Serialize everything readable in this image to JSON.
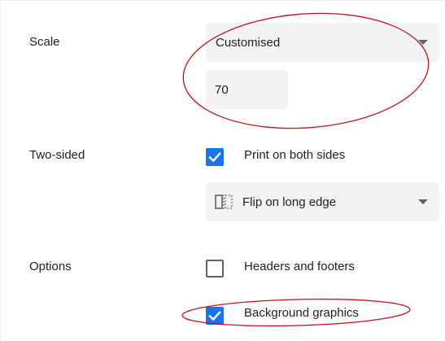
{
  "scale": {
    "label": "Scale",
    "select_value": "Customised",
    "input_value": "70"
  },
  "two_sided": {
    "label": "Two-sided",
    "checkbox_label": "Print on both sides",
    "checked": true,
    "select_value": "Flip on long edge"
  },
  "options": {
    "label": "Options",
    "headers_footers_label": "Headers and footers",
    "headers_footers_checked": false,
    "background_graphics_label": "Background graphics",
    "background_graphics_checked": true
  },
  "colors": {
    "accent": "#1a73e8",
    "field_background": "#f1f3f4",
    "annotation": "#c0131e"
  },
  "icons": {
    "dropdown": "chevron-down-icon",
    "flip": "flip-long-edge-icon",
    "check": "check-icon"
  }
}
